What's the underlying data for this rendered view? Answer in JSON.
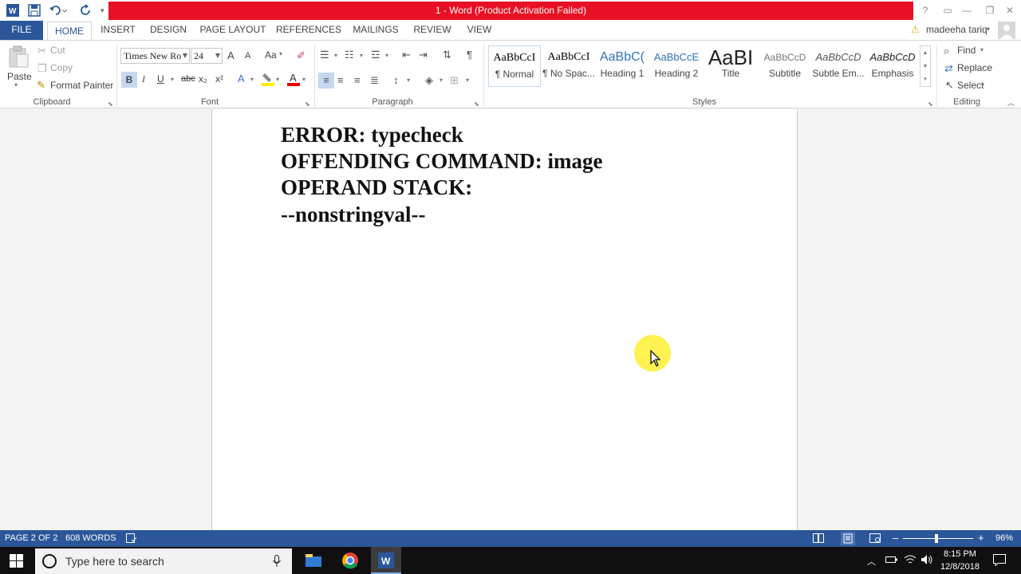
{
  "window": {
    "title": "1  -  Word (Product Activation Failed)",
    "help": "?",
    "minimize": "—",
    "restore": "❐",
    "close": "✕"
  },
  "tabs": [
    "FILE",
    "HOME",
    "INSERT",
    "DESIGN",
    "PAGE LAYOUT",
    "REFERENCES",
    "MAILINGS",
    "REVIEW",
    "VIEW"
  ],
  "user": {
    "name": "madeeha tariq"
  },
  "clipboard": {
    "paste": "Paste",
    "cut": "Cut",
    "copy": "Copy",
    "format_painter": "Format Painter",
    "group": "Clipboard"
  },
  "font": {
    "name": "Times New Ro",
    "size": "24",
    "group": "Font",
    "bold": "B",
    "italic": "I",
    "underline": "U",
    "strike": "abc",
    "subscript": "x₂",
    "superscript": "x²",
    "grow": "A",
    "shrink": "A",
    "case": "Aa"
  },
  "paragraph": {
    "group": "Paragraph"
  },
  "styles": {
    "group": "Styles",
    "items": [
      {
        "sample": "AaBbCcI",
        "name": "¶ Normal"
      },
      {
        "sample": "AaBbCcI",
        "name": "¶ No Spac..."
      },
      {
        "sample": "AaBbC(",
        "name": "Heading 1"
      },
      {
        "sample": "AaBbCcE",
        "name": "Heading 2"
      },
      {
        "sample": "AaBI",
        "name": "Title"
      },
      {
        "sample": "AaBbCcD",
        "name": "Subtitle"
      },
      {
        "sample": "AaBbCcD",
        "name": "Subtle Em..."
      },
      {
        "sample": "AaBbCcD",
        "name": "Emphasis"
      }
    ]
  },
  "editing": {
    "find": "Find",
    "replace": "Replace",
    "select": "Select",
    "group": "Editing"
  },
  "document": {
    "lines": [
      "ERROR: typecheck",
      "OFFENDING COMMAND: image",
      "OPERAND STACK:",
      "--nonstringval--"
    ]
  },
  "status": {
    "page": "PAGE 2 OF 2",
    "words": "608 WORDS",
    "zoom": "96%",
    "zoom_level": 0.48
  },
  "taskbar": {
    "search_placeholder": "Type here to search",
    "time": "8:15 PM",
    "date": "12/8/2018"
  },
  "colors": {
    "word_blue": "#2b579a",
    "alert_red": "#e81123",
    "highlight_yellow": "#ffee32"
  },
  "icons": [
    "word-logo-icon",
    "save-icon",
    "undo-icon",
    "redo-icon",
    "warning-icon",
    "windows-start-icon",
    "cortana-icon",
    "microphone-icon",
    "chrome-icon",
    "word-taskbar-icon"
  ]
}
